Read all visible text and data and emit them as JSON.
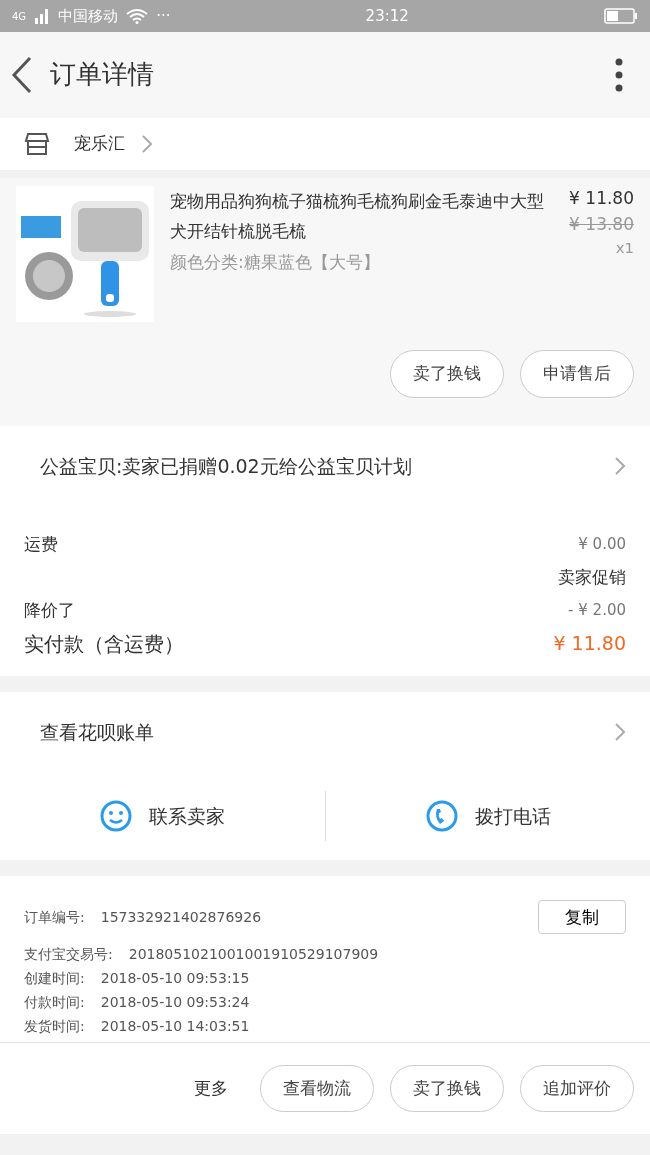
{
  "status_bar": {
    "network": "4G",
    "carrier": "中国移动",
    "dots": "···",
    "time": "23:12"
  },
  "header": {
    "title": "订单详情"
  },
  "shop": {
    "name": "宠乐汇"
  },
  "product": {
    "image": {
      "kind": "picture"
    },
    "title": "宠物用品狗狗梳子猫梳狗毛梳狗刷金毛泰迪中大型犬开结针梳脱毛梳",
    "variant": "颜色分类:糖果蓝色【大号】",
    "price": "¥ 11.80",
    "original_price": "¥ 13.80",
    "quantity": "x1",
    "buttons": [
      "卖了换钱",
      "申请售后"
    ]
  },
  "charity": {
    "text": "公益宝贝:卖家已捐赠0.02元给公益宝贝计划"
  },
  "fees": [
    {
      "label": "运费",
      "value": "¥ 0.00",
      "kind": "plain"
    },
    {
      "value": "卖家促销",
      "kind": "note"
    },
    {
      "label": "降价了",
      "value": "- ¥ 2.00",
      "kind": "plain"
    },
    {
      "label": "实付款（含运费）",
      "value": "¥ 11.80",
      "kind": "total"
    }
  ],
  "huabei": {
    "text": "查看花呗账单"
  },
  "contact": [
    {
      "label": "联系卖家",
      "kind": "chat"
    },
    {
      "label": "拨打电话",
      "kind": "phone"
    }
  ],
  "order_info": {
    "copy_button": "复制",
    "rows": [
      {
        "label": "订单编号:",
        "value": "157332921402876926"
      },
      {
        "label": "支付宝交易号:",
        "value": "2018051021001001910529107909"
      },
      {
        "label": "创建时间:",
        "value": "2018-05-10 09:53:15"
      },
      {
        "label": "付款时间:",
        "value": "2018-05-10 09:53:24"
      },
      {
        "label": "发货时间:",
        "value": "2018-05-10 14:03:51"
      }
    ]
  },
  "bottom_bar": {
    "more": "更多",
    "buttons": [
      "查看物流",
      "卖了换钱",
      "追加评价"
    ]
  }
}
